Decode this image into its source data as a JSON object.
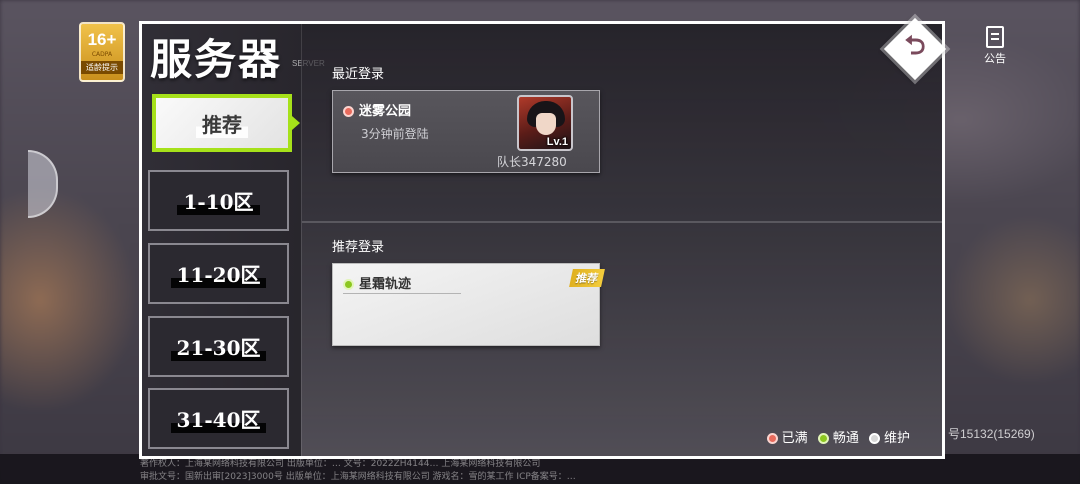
{
  "background": {
    "age_rating": "16+",
    "age_org": "CADPA",
    "age_tip": "适龄提示",
    "notice_label": "公告",
    "player_id": "号15132(15269)",
    "footer_line1": "著作权人：上海某网络科技有限公司   出版单位：…   文号：2022ZH4144…   上海某网络科技有限公司",
    "footer_line2": "审批文号：国新出审[2023]3000号        出版单位：上海某网络科技有限公司        游戏名：雪的某工作    ICP备案号：…"
  },
  "panel": {
    "title": "服务器",
    "title_sub": "SERVER",
    "tabs": [
      {
        "label": "推荐",
        "active": true
      },
      {
        "label": "1-10区",
        "active": false
      },
      {
        "label": "11-20区",
        "active": false
      },
      {
        "label": "21-30区",
        "active": false
      },
      {
        "label": "31-40区",
        "active": false
      }
    ],
    "recent": {
      "heading": "最近登录",
      "server_name": "迷雾公园",
      "status": "full",
      "last_login": "3分钟前登陆",
      "level": "Lv.1",
      "captain": "队长347280"
    },
    "recommended": {
      "heading": "推荐登录",
      "server_name": "星霜轨迹",
      "status": "smooth",
      "badge": "推荐"
    },
    "legend": {
      "full": "已满",
      "smooth": "畅通",
      "maintenance": "维护"
    }
  },
  "colors": {
    "status_full": "#e86a5c",
    "status_smooth": "#8cc71f",
    "status_maintenance": "#d7d7d7",
    "active_tab_border": "#a6e11a",
    "badge": "#e0b020"
  },
  "icons": {
    "back": "return-arrow-icon",
    "notice": "notice-board-icon"
  }
}
